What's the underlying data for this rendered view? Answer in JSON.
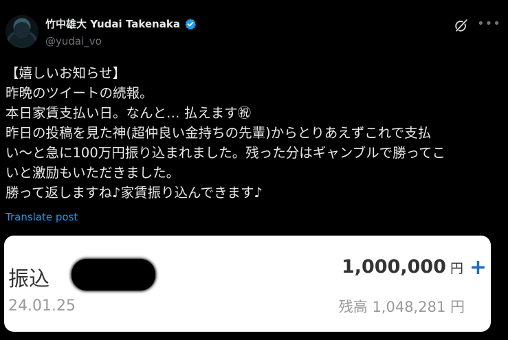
{
  "author": {
    "display_name": "竹中雄大 Yudai Takenaka",
    "handle": "@yudai_vo"
  },
  "post": {
    "text": "【嬉しいお知らせ】\n昨晩のツイートの続報。\n本日家賃支払い日。なんと… 払えます㊗\n昨日の投稿を見た神(超仲良い金持ちの先輩)からとりあえずこれで支払\nい～と急に100万円振り込まれました。残った分はギャンブルで勝ってこ\nいと激励もいただきました。\n勝って返しますね♪家賃振り込んできます♪",
    "translate_label": "Translate post"
  },
  "card": {
    "label": "振込",
    "amount": "1,000,000",
    "amount_unit": "円",
    "plus": "+",
    "date": "24.01.25",
    "balance": "残高 1,048,281 円"
  },
  "icons": {
    "verified": "verified-badge-icon",
    "grok": "grok-icon",
    "more": "more-icon"
  },
  "colors": {
    "accent": "#1d9bf0",
    "background": "#000000",
    "text": "#e7e9ea",
    "muted": "#71767b"
  }
}
